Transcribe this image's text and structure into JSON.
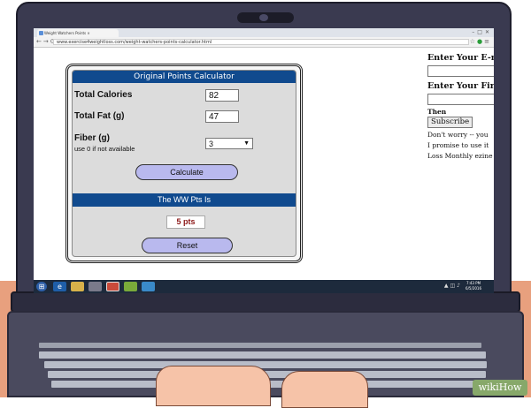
{
  "browser": {
    "tab_title": "Weight Watchers Points ×",
    "url": "www.exercise4weightloss.com/weight-watchers-points-calculator.html"
  },
  "calculator": {
    "title": "Original Points Calculator",
    "calories_label": "Total Calories",
    "calories_value": "82",
    "fat_label": "Total Fat (g)",
    "fat_value": "47",
    "fiber_label": "Fiber (g)",
    "fiber_hint": "use 0 if not available",
    "fiber_value": "3",
    "calculate_label": "Calculate",
    "result_heading": "The WW Pts Is",
    "result_value": "5 pts",
    "reset_label": "Reset"
  },
  "sidebar": {
    "email_label": "Enter Your E-m",
    "first_label": "Enter Your First",
    "then_label": "Then",
    "subscribe_label": "Subscribe",
    "note_1": "Don't worry -- you",
    "note_2": "I promise to use it",
    "note_3": "Loss Monthly ezine"
  },
  "taskbar": {
    "time": "7:43 PM",
    "date": "6/5/2016",
    "icons": [
      "windows-start-icon",
      "ie-icon",
      "folder-icon",
      "media-icon",
      "chrome-icon",
      "app-icon",
      "app2-icon"
    ]
  },
  "watermark": "wikiHow"
}
